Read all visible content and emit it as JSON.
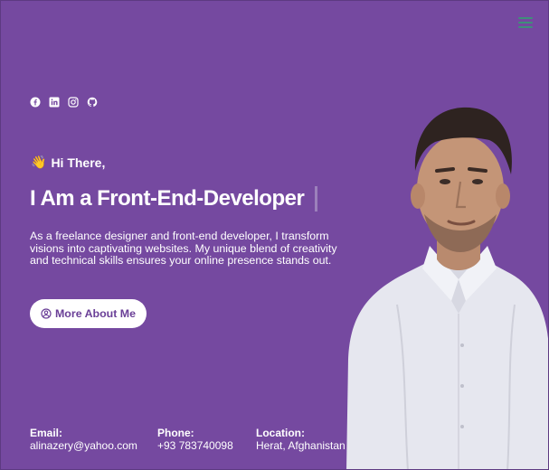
{
  "nav": {
    "menu_icon": "hamburger-icon"
  },
  "socials": [
    {
      "name": "facebook",
      "icon": "facebook-icon"
    },
    {
      "name": "linkedin",
      "icon": "linkedin-icon"
    },
    {
      "name": "instagram",
      "icon": "instagram-icon"
    },
    {
      "name": "github",
      "icon": "github-icon"
    }
  ],
  "hero": {
    "greeting_emoji": "👋",
    "greeting": "Hi There,",
    "headline_prefix": "I Am a",
    "headline_role": "Front-End-Developer",
    "intro": "As a freelance designer and front-end developer, I transform visions into captivating websites. My unique blend of creativity and technical skills ensures your online presence stands out.",
    "cta_label": "More About Me",
    "cta_icon": "user-circle-icon"
  },
  "contact": {
    "email_label": "Email:",
    "email": "alinazery@yahoo.com",
    "phone_label": "Phone:",
    "phone": "+93 783740098",
    "location_label": "Location:",
    "location": "Herat, Afghanistan"
  },
  "colors": {
    "background": "#7549a0",
    "button_bg": "#ffffff",
    "button_text": "#6a3f97",
    "menu_icon": "#3f8f7a"
  }
}
